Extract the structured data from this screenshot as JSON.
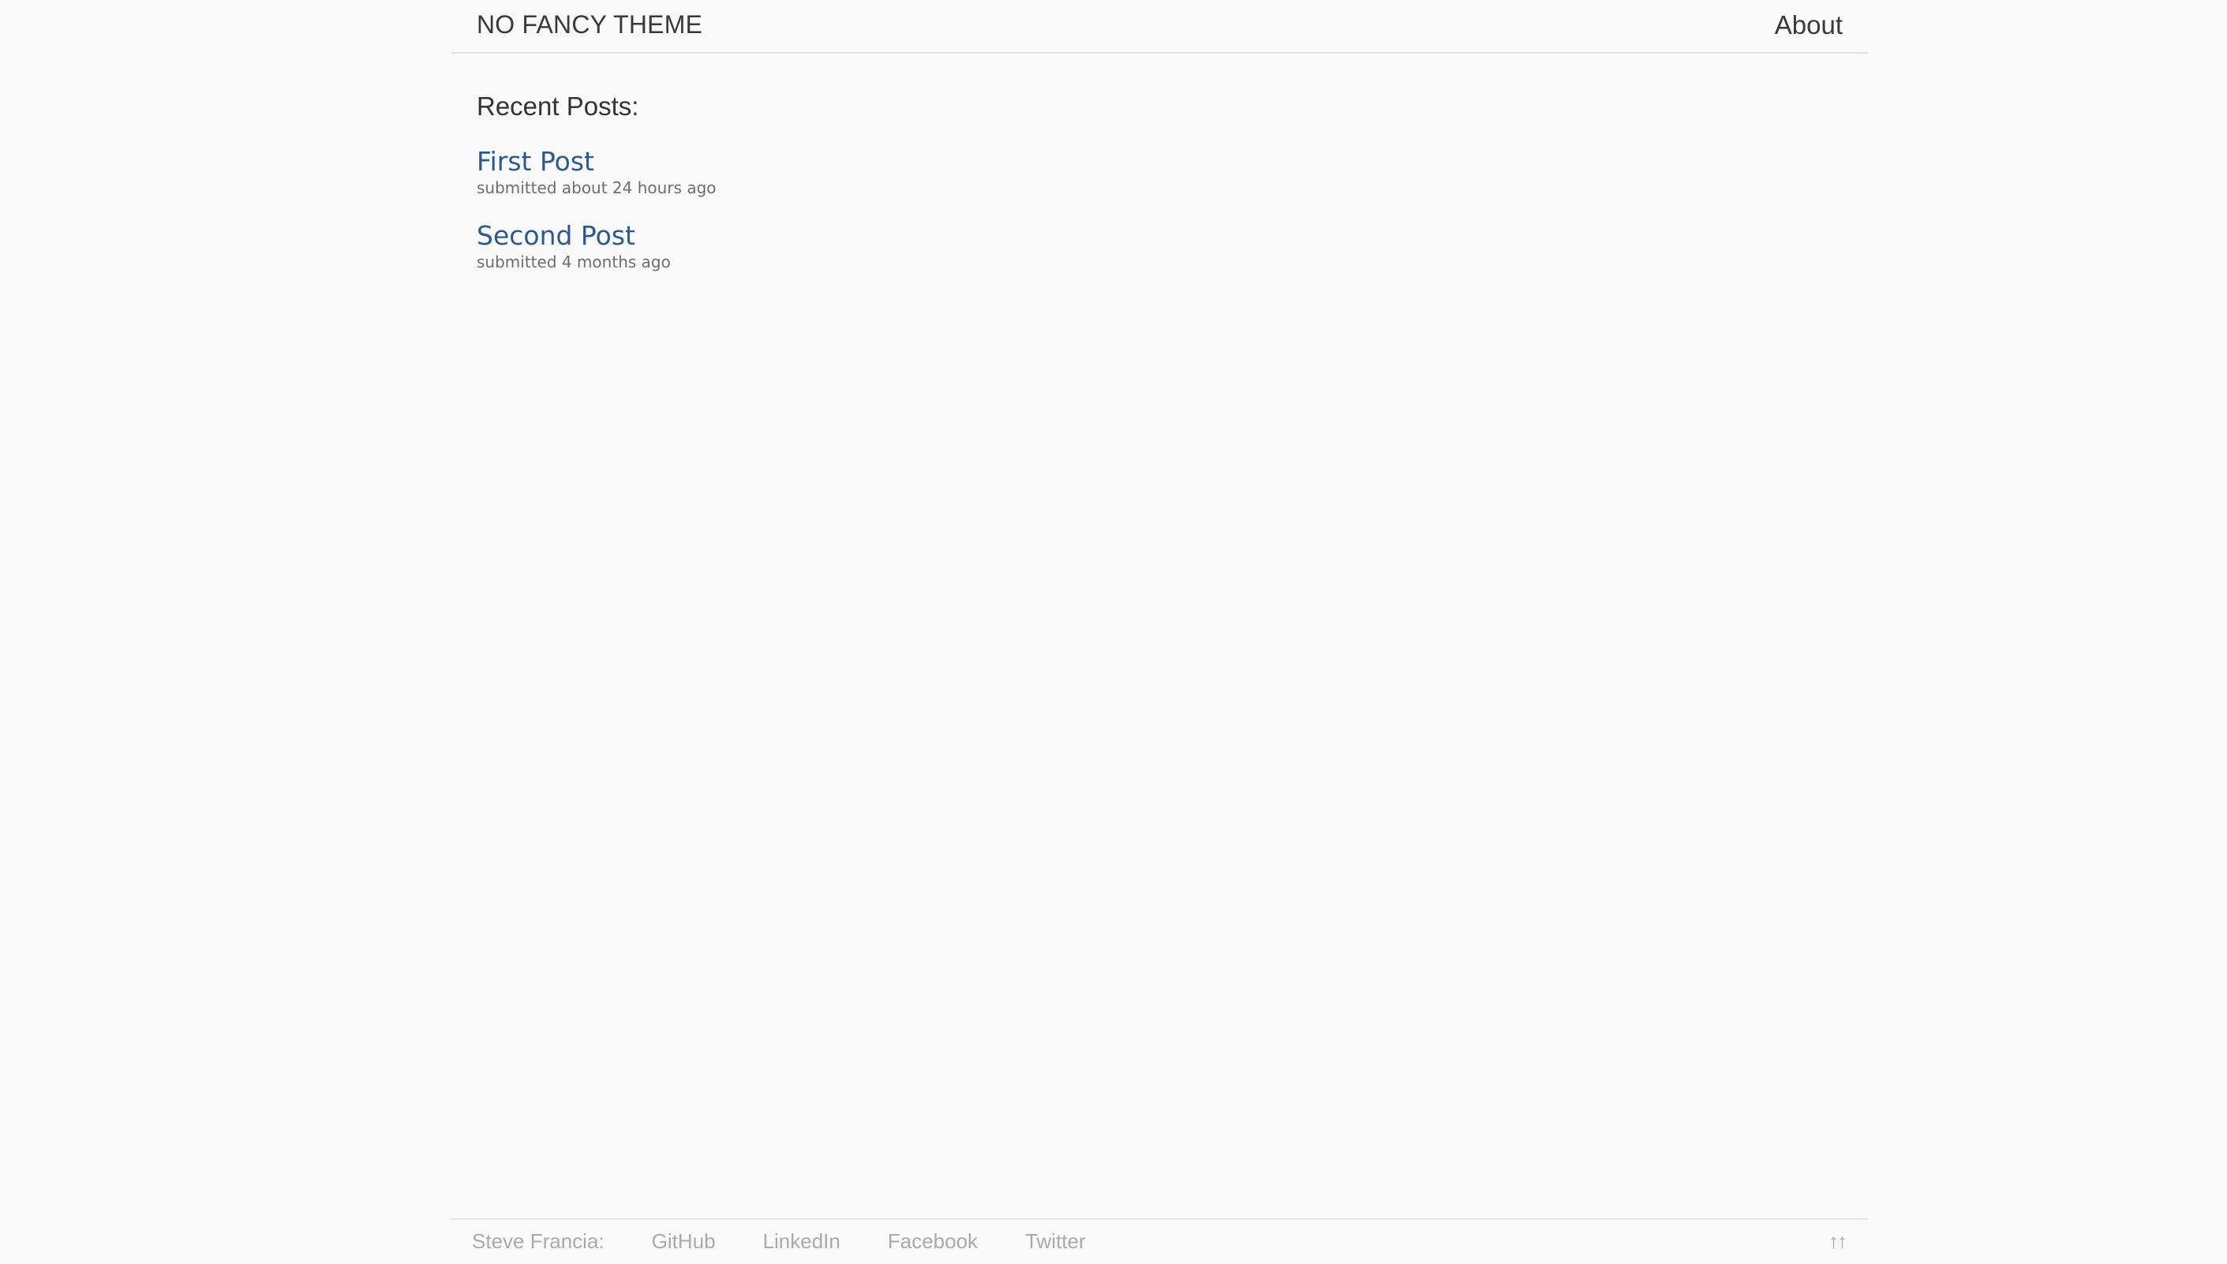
{
  "header": {
    "site_title": "NO FANCY THEME",
    "nav": [
      {
        "label": "About"
      }
    ]
  },
  "main": {
    "heading": "Recent Posts:",
    "posts": [
      {
        "title": "First Post",
        "meta": "submitted about 24 hours ago"
      },
      {
        "title": "Second Post",
        "meta": "submitted 4 months ago"
      }
    ]
  },
  "footer": {
    "owner": "Steve Francia:",
    "links": [
      {
        "label": "GitHub"
      },
      {
        "label": "LinkedIn"
      },
      {
        "label": "Facebook"
      },
      {
        "label": "Twitter"
      }
    ],
    "back_to_top": "↑↑"
  },
  "colors": {
    "background": "#f9f9f9",
    "link": "#2a5a8f",
    "text": "#3a3a3a",
    "muted": "#aaaaaa"
  }
}
